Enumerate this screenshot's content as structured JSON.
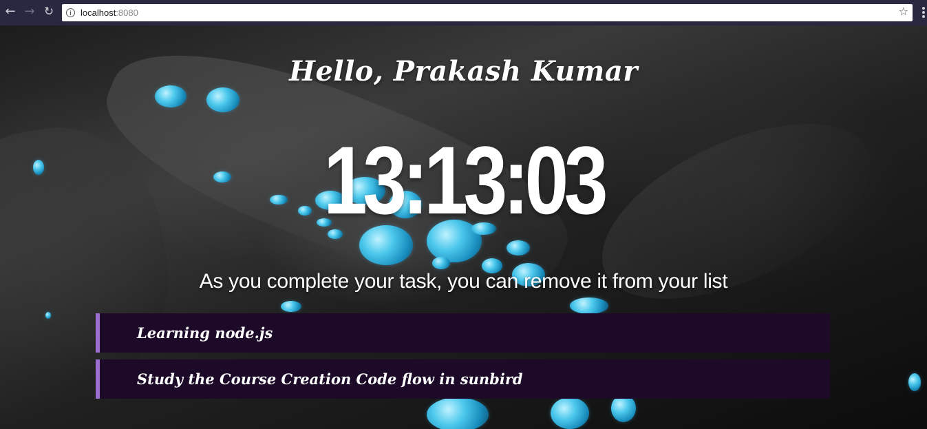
{
  "browser": {
    "url_host": "localhost",
    "url_port": ":8080",
    "back_icon": "←",
    "forward_icon": "→",
    "reload_icon": "↻",
    "info_icon": "i",
    "star_icon": "☆"
  },
  "page": {
    "greeting": "Hello, Prakash Kumar",
    "clock": "13:13:03",
    "subtitle": "As you complete your task, you can remove it from your list",
    "tasks": [
      {
        "label": "Learning node.js"
      },
      {
        "label": "Study the Course Creation Code flow in sunbird"
      }
    ]
  },
  "colors": {
    "task_background": "#1c0a28",
    "task_accent": "#9b6fd0",
    "text": "#ffffff",
    "water_drop": "#4cc8ec"
  }
}
